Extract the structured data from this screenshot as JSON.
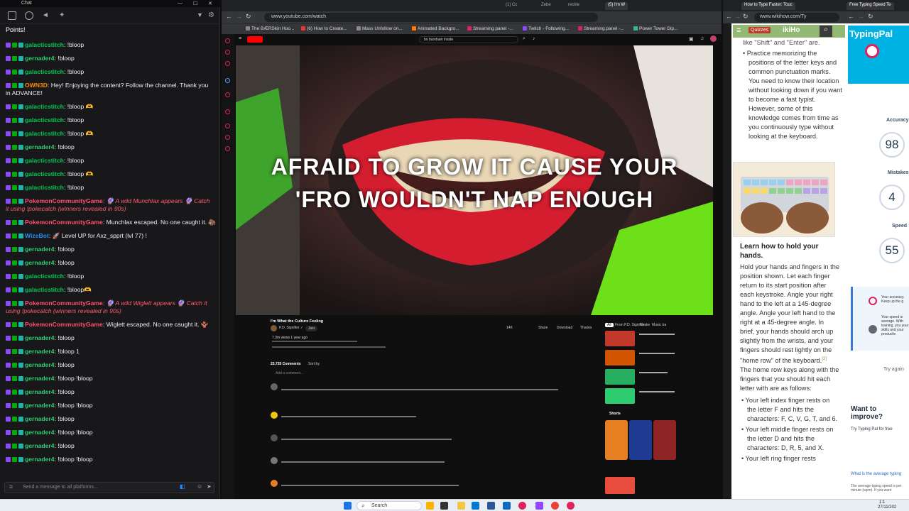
{
  "chat": {
    "window_title": "Chat",
    "points_label": "Points!",
    "input_placeholder": "Send a message to all platforms...",
    "messages": [
      {
        "user": "galacticstitch",
        "text": ": !bloop"
      },
      {
        "user": "gernader4",
        "text": ": !bloop"
      },
      {
        "user": "galacticstitch",
        "text": ": !bloop"
      },
      {
        "user": "OWN3D",
        "text": ": Hey! Enjoying the content? Follow the channel. Thank you in ADVANCE!"
      },
      {
        "user": "galacticstitch",
        "text": ": !bloop 🫶"
      },
      {
        "user": "galacticstitch",
        "text": ": !bloop"
      },
      {
        "user": "galacticstitch",
        "text": ": !bloop 🫶"
      },
      {
        "user": "gernader4",
        "text": ": !bloop"
      },
      {
        "user": "galacticstitch",
        "text": ": !bloop"
      },
      {
        "user": "galacticstitch",
        "text": ": !bloop 🫶"
      },
      {
        "user": "galacticstitch",
        "text": ": !bloop"
      },
      {
        "user": "PokemonCommunityGame",
        "text": ": 🔮 A wild Munchlax appears 🔮 Catch it using !pokecatch (winners revealed in 90s)"
      },
      {
        "user": "PokemonCommunityGame",
        "text": ": Munchlax escaped. No one caught it. 🦣"
      },
      {
        "user": "WizeBot",
        "text": ": 🚀 Level UP for Axz_spprt (lvl 77) !"
      },
      {
        "user": "gernader4",
        "text": ": !bloop"
      },
      {
        "user": "gernader4",
        "text": ": !bloop"
      },
      {
        "user": "galacticstitch",
        "text": ": !bloop"
      },
      {
        "user": "galacticstitch",
        "text": ": !bloop🫶"
      },
      {
        "user": "PokemonCommunityGame",
        "text": ": 🔮 A wild Wiglett appears 🔮 Catch it using !pokecatch (winners revealed in 90s)"
      },
      {
        "user": "PokemonCommunityGame",
        "text": ": Wiglett escaped. No one caught it. 🪸"
      },
      {
        "user": "gernader4",
        "text": ": !bloop"
      },
      {
        "user": "gernader4",
        "text": ": !bloop 1"
      },
      {
        "user": "gernader4",
        "text": ": !bloop"
      },
      {
        "user": "gernader4",
        "text": ": !bloop !bloop"
      },
      {
        "user": "gernader4",
        "text": ": !bloop"
      },
      {
        "user": "gernader4",
        "text": ": !bloop !bloop"
      },
      {
        "user": "gernader4",
        "text": ": !bloop"
      },
      {
        "user": "gernader4",
        "text": ": !bloop !bloop"
      },
      {
        "user": "gernader4",
        "text": ": !bloop"
      },
      {
        "user": "gernader4",
        "text": ": !bloop !bloop"
      }
    ]
  },
  "browser1": {
    "url": "www.youtube.com/watch",
    "tabs": [
      "(1) Cc",
      "Zebe",
      "reckle",
      "(5) I'm W"
    ],
    "bookmarks": [
      "The BÆRSkin Hoo...",
      "(6) How to Create...",
      "Mass Unfollow on...",
      "Animated Backgro...",
      "Streaming panel -...",
      "Twitch - Following...",
      "Streaming panel -...",
      "Power Tower Dip..."
    ],
    "search_query": "bo burnham inside",
    "lyric_line1": "AFRAID TO GROW IT CAUSE YOUR",
    "lyric_line2": "'FRO WOULDN'T NAP ENOUGH",
    "video_title": "I'm What the Culture Feeling",
    "channel": "P.D. Signifier ✓",
    "join_label": "Join",
    "likes": "14K",
    "share_label": "Share",
    "download_label": "Download",
    "thanks_label": "Thanks",
    "views_line": "7.3m views 1 year ago",
    "comments_count": "25,735 Comments",
    "sort_label": "Sort by",
    "add_comment": "Add a comment...",
    "filter_all": "All",
    "filter_from": "From P.D. Signifier",
    "filter_drake": "Drake",
    "filter_music": "Music tra",
    "shorts_label": "Shorts"
  },
  "browser2": {
    "url": "www.wikihow.com/Ty",
    "tab_title": "How to Type Faster: Touc",
    "quiz_label": "Quizzes",
    "para1": "like \"Shift\" and \"Enter\" are.",
    "bullet1": "Practice memorizing the positions of the letter keys and common punctuation marks. You need to know their location without looking down if you want to become a fast typist. However, some of this knowledge comes from time as you continuously type without looking at the keyboard.",
    "heading": "Learn how to hold your hands.",
    "body": "Hold your hands and fingers in the position shown. Let each finger return to its start position after each keystroke. Angle your right hand to the left at a 145-degree angle. Angle your left hand to the right at a 45-degree angle. In brief, your hands should arch up slightly from the wrists, and your fingers should rest lightly on the \"home row\" of the keyboard.",
    "ref": "[2]",
    "body2": " The home row keys along with the fingers that you should hit each letter with are as follows:",
    "li1": "Your left index finger rests on the letter F and hits the characters: F, C, V, G, T, and 6.",
    "li2": "Your left middle finger rests on the letter D and hits the characters: D, R, 5, and X.",
    "li3": "Your left ring finger rests"
  },
  "browser3": {
    "tab_title": "Free Typing Speed Te",
    "brand": "TypingPal",
    "accuracy_label": "Accuracy",
    "accuracy_value": "98",
    "mistakes_label": "Mistakes",
    "mistakes_value": "4",
    "speed_label": "Speed",
    "speed_value": "55",
    "tip1": "Your accuracy. Keep up the g",
    "tip2": "Your speed is average. With training, you your skills and your productiv",
    "try_again": "Try again",
    "want_improve": "Want to improve?",
    "try_pal": "Try Typing Pal for free",
    "avg_title": "What is the average typing",
    "avg_text": "The average typing speed is per minute (wpm). If you want"
  },
  "taskbar": {
    "search_label": "Search",
    "date": "27/11/202",
    "time": "1:1"
  },
  "colors": {
    "twitch_purple": "#9147ff",
    "pokemon_red": "#ff4f6d",
    "wikihow_green": "#93b874",
    "typingpal_red": "#e0215b"
  }
}
